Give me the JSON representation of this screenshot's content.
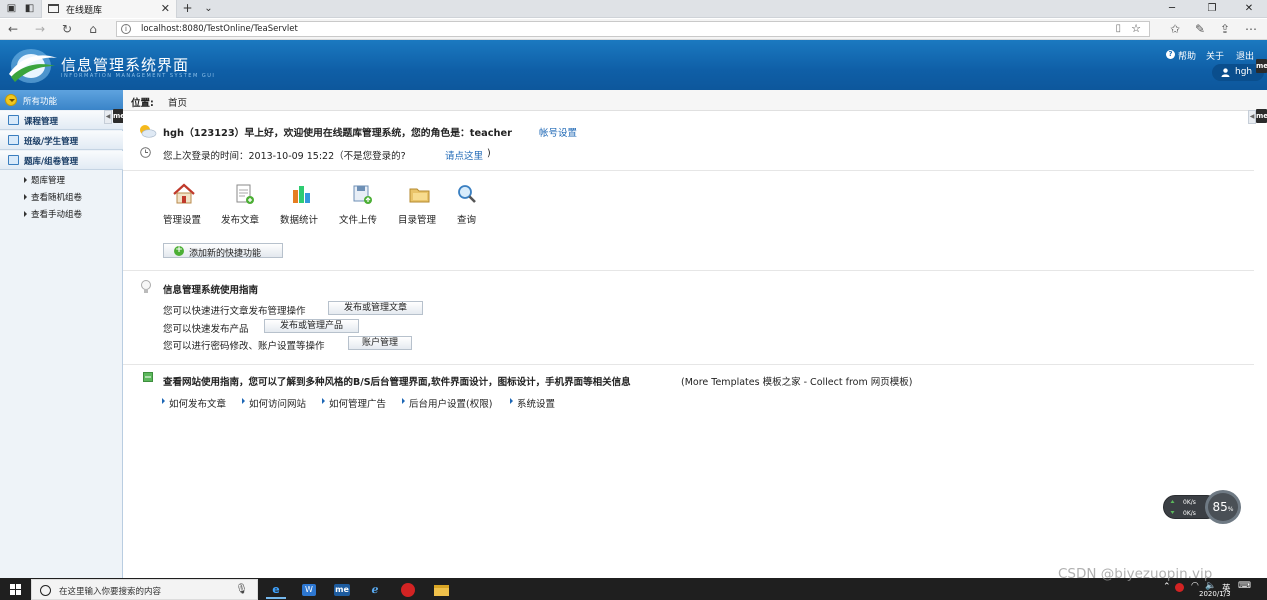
{
  "browser": {
    "tab_title": "在线题库",
    "url": "localhost:8080/TestOnline/TeaServlet"
  },
  "header": {
    "title": "信息管理系统界面",
    "subtitle": "INFORMATION MANAGEMENT SYSTEM GUI",
    "help_label": "帮助",
    "about_label": "关于",
    "exit_label": "退出",
    "username": "hgh",
    "brand_color": "#1169b2"
  },
  "sidebar": {
    "all_functions": "所有功能",
    "categories": [
      {
        "label": "课程管理"
      },
      {
        "label": "班级/学生管理"
      },
      {
        "label": "题库/组卷管理"
      }
    ],
    "subitems": [
      {
        "label": "题库管理"
      },
      {
        "label": "查看随机组卷"
      },
      {
        "label": "查看手动组卷"
      }
    ]
  },
  "main": {
    "location_label": "位置:",
    "location_value": "首页",
    "greeting": "hgh（123123）早上好，欢迎使用在线题库管理系统，您的角色是：teacher",
    "account_settings": "帐号设置",
    "last_login": "您上次登录的时间：2013-10-09 15:22（不是您登录的?",
    "click_here": "请点这里",
    "click_here_suffix": ")",
    "quick_actions": [
      {
        "label": "管理设置",
        "icon": "house-icon"
      },
      {
        "label": "发布文章",
        "icon": "document-add-icon"
      },
      {
        "label": "数据统计",
        "icon": "bar-chart-icon"
      },
      {
        "label": "文件上传",
        "icon": "upload-icon"
      },
      {
        "label": "目录管理",
        "icon": "folder-icon"
      },
      {
        "label": "查询",
        "icon": "magnifier-icon"
      }
    ],
    "add_shortcut": "添加新的快捷功能",
    "guide": {
      "title": "信息管理系统使用指南",
      "rows": [
        {
          "text": "您可以快速进行文章发布管理操作",
          "button": "发布或管理文章"
        },
        {
          "text": "您可以快速发布产品",
          "button": "发布或管理产品"
        },
        {
          "text": "您可以进行密码修改、账户设置等操作",
          "button": "账户管理"
        }
      ]
    },
    "website_guide": {
      "title": "查看网站使用指南，您可以了解到多种风格的B/S后台管理界面,软件界面设计，图标设计，手机界面等相关信息",
      "credit": "(More Templates 模板之家 - Collect from 网页模板)",
      "links": [
        "如何发布文章",
        "如何访问网站",
        "如何管理广告",
        "后台用户设置(权限)",
        "系统设置"
      ]
    }
  },
  "speed_widget": {
    "up": "0K/s",
    "down": "0K/s",
    "percent": "85",
    "percent_unit": "%"
  },
  "taskbar": {
    "search_placeholder": "在这里输入你要搜索的内容",
    "ime": "英",
    "date": "2020/1/3"
  },
  "watermark": "CSDN @biyezuopin.vip"
}
